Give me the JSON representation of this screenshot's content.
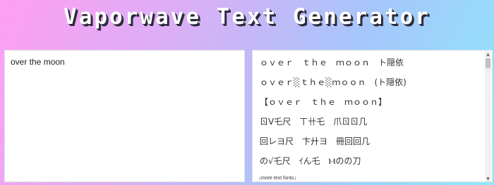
{
  "header": {
    "title": "Vaporwave Text Generator"
  },
  "input": {
    "value": "over the moon"
  },
  "output": {
    "lines": [
      "ｏｖｅｒ　ｔｈｅ　ｍｏｏｎ　ト隠依",
      "ｏｖｅｒ░ｔｈｅ░ｍｏｏｎ　(ト隠依)",
      "【ｏｖｅｒ　ｔｈｅ　ｍｏｏｎ】",
      "ㄖV乇尺　ㄒ卄乇　爪ㄖㄖ几",
      "回レヨ尺　卞廾ヨ　冊回回几",
      "の√乇尺　ｲん乇　Ⲙのの刀"
    ],
    "more_fonts_label": "more text fonts"
  },
  "icons": {
    "scroll_up": "triangle-up-icon",
    "scroll_down": "triangle-down-icon",
    "more_arrow": "arrow-down-icon"
  }
}
